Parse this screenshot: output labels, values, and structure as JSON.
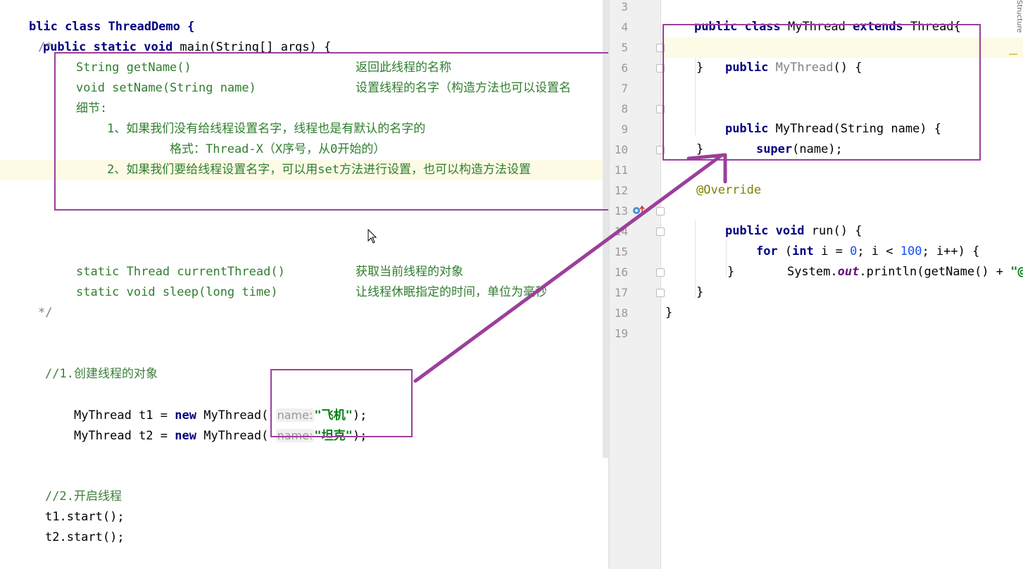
{
  "left_editor": {
    "lines": {
      "class_decl": "blic class ThreadDemo {",
      "main_decl_kw": "public static void",
      "main_decl_rest": " main(String[] args) {",
      "comment_open": "/*",
      "doc_getname_sig": "String getName()",
      "doc_getname_desc": "返回此线程的名称",
      "doc_setname_sig": "void setName(String name)",
      "doc_setname_desc": "设置线程的名字（构造方法也可以设置名",
      "doc_details": "细节:",
      "doc_item1": "1、如果我们没有给线程设置名字，线程也是有默认的名字的",
      "doc_item1_format": "格式：Thread-X（X序号，从0开始的）",
      "doc_item2": "2、如果我们要给线程设置名字，可以用set方法进行设置，也可以构造方法设置",
      "doc_current_sig": "static Thread currentThread()",
      "doc_current_desc": "获取当前线程的对象",
      "doc_sleep_sig": "static void sleep(long time)",
      "doc_sleep_desc": "让线程休眠指定的时间，单位为毫秒",
      "comment_close": "*/",
      "step1_comment": "//1.创建线程的对象",
      "t1_prefix": "MyThread t1 = ",
      "t2_prefix": "MyThread t2 = ",
      "new_kw": "new",
      "ctor_call": " MyThread(",
      "param_hint": "name:",
      "t1_arg": "\"飞机\"",
      "t2_arg": "\"坦克\"",
      "call_end": ");",
      "step2_comment": "//2.开启线程",
      "t1_start": "t1.start();",
      "t2_start": "t2.start();"
    }
  },
  "right_editor": {
    "line_numbers": [
      "3",
      "4",
      "5",
      "6",
      "7",
      "8",
      "9",
      "10",
      "11",
      "12",
      "13",
      "14",
      "15",
      "16",
      "17",
      "18",
      "19"
    ],
    "lines": {
      "class_kw": "public class",
      "class_name": " MyThread ",
      "extends_kw": "extends",
      "class_rest": " Thread{",
      "public_kw": "public",
      "ctor1_name": " MyThread",
      "ctor1_rest": "() {",
      "close_brace": "}",
      "ctor2_rest": " MyThread(String name) {",
      "super_kw": "super",
      "super_rest": "(name);",
      "override": "@Override",
      "run_kw": "public void",
      "run_rest": " run() {",
      "for_kw": "for",
      "for_open": " (",
      "int_kw": "int",
      "for_i_decl": " i = ",
      "zero": "0",
      "for_mid": "; i < ",
      "hundred": "100",
      "for_end": "; i++) {",
      "println_prefix": "System.",
      "out_field": "out",
      "println_rest": ".println(getName() + ",
      "println_str": "\"@"
    }
  },
  "side_tab": "Structure",
  "colors": {
    "annotation_box": "#9b3f9b",
    "arrow": "#9b3f9b"
  }
}
